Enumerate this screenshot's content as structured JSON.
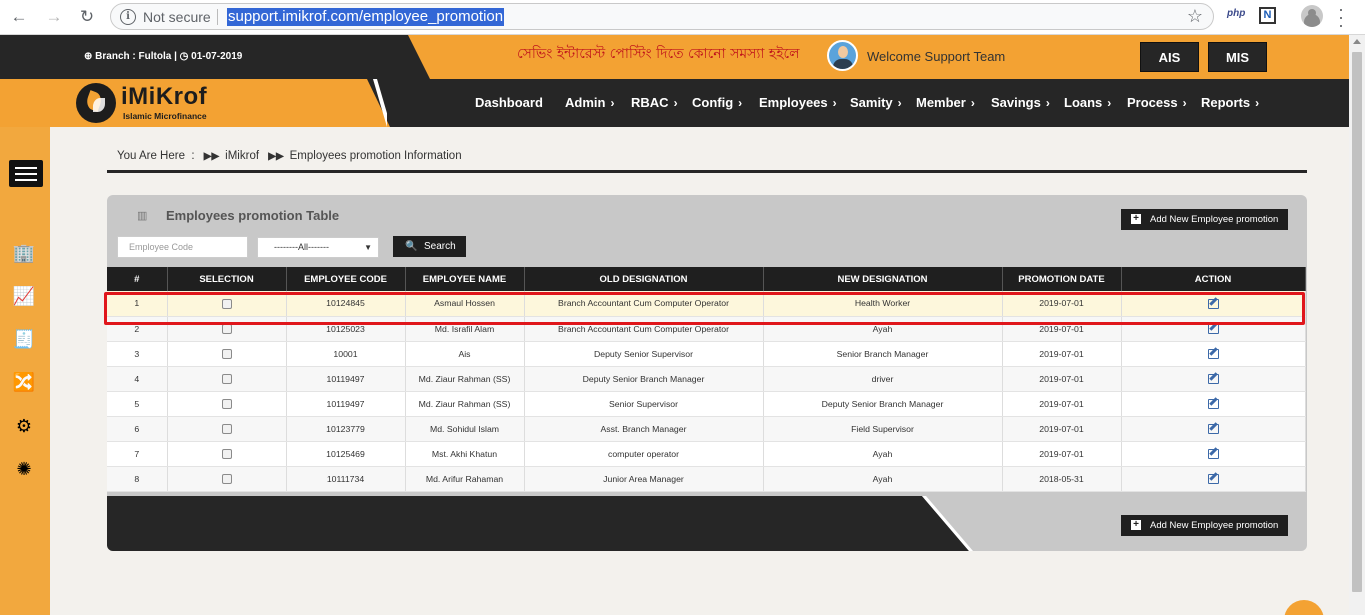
{
  "browser": {
    "security_label": "Not secure",
    "url": "support.imikrof.com/employee_promotion",
    "ext_php": "php",
    "ext_n": "N"
  },
  "topbar": {
    "branch": "Branch : Fultola |",
    "date": "01-07-2019",
    "marquee": "সেভিং ইন্টারেস্ট পোস্টিং দিতে কোনো সমস্যা হইলে ঃ",
    "welcome": "Welcome Support Team",
    "ais_label": "AIS",
    "mis_label": "MIS"
  },
  "logo": {
    "name": "iMiKrof",
    "tagline": "Islamic Microfinance"
  },
  "menu": [
    "Dashboard",
    "Admin",
    "RBAC",
    "Config",
    "Employees",
    "Samity",
    "Member",
    "Savings",
    "Loans",
    "Process",
    "Reports"
  ],
  "breadcrumb": {
    "prefix": "You Are Here",
    "sep": ":",
    "root": "iMikrof",
    "current": "Employees promotion Information"
  },
  "panel": {
    "title": "Employees promotion Table",
    "add_label": "Add New Employee promotion",
    "code_placeholder": "Employee Code",
    "select_value": "--------All-------",
    "search_label": "Search"
  },
  "table": {
    "headers": [
      "#",
      "SELECTION",
      "EMPLOYEE CODE",
      "EMPLOYEE NAME",
      "OLD DESIGNATION",
      "NEW DESIGNATION",
      "PROMOTION DATE",
      "ACTION"
    ],
    "rows": [
      {
        "num": "1",
        "code": "10124845",
        "name": "Asmaul Hossen",
        "old": "Branch Accountant Cum Computer Operator",
        "new": "Health Worker",
        "date": "2019-07-01"
      },
      {
        "num": "2",
        "code": "10125023",
        "name": "Md. Israfil Alam",
        "old": "Branch Accountant Cum Computer Operator",
        "new": "Ayah",
        "date": "2019-07-01"
      },
      {
        "num": "3",
        "code": "10001",
        "name": "Ais",
        "old": "Deputy Senior Supervisor",
        "new": "Senior Branch Manager",
        "date": "2019-07-01"
      },
      {
        "num": "4",
        "code": "10119497",
        "name": "Md. Ziaur Rahman (SS)",
        "old": "Deputy Senior Branch Manager",
        "new": "driver",
        "date": "2019-07-01"
      },
      {
        "num": "5",
        "code": "10119497",
        "name": "Md. Ziaur Rahman (SS)",
        "old": "Senior Supervisor",
        "new": "Deputy Senior Branch Manager",
        "date": "2019-07-01"
      },
      {
        "num": "6",
        "code": "10123779",
        "name": "Md. Sohidul Islam",
        "old": "Asst. Branch Manager",
        "new": "Field Supervisor",
        "date": "2019-07-01"
      },
      {
        "num": "7",
        "code": "10125469",
        "name": "Mst. Akhi Khatun",
        "old": "computer operator",
        "new": "Ayah",
        "date": "2019-07-01"
      },
      {
        "num": "8",
        "code": "10111734",
        "name": "Md. Arifur Rahaman",
        "old": "Junior Area Manager",
        "new": "Ayah",
        "date": "2018-05-31"
      }
    ]
  },
  "colors": {
    "accent": "#f3a233",
    "dark": "#262626",
    "highlight": "#e0161b"
  }
}
